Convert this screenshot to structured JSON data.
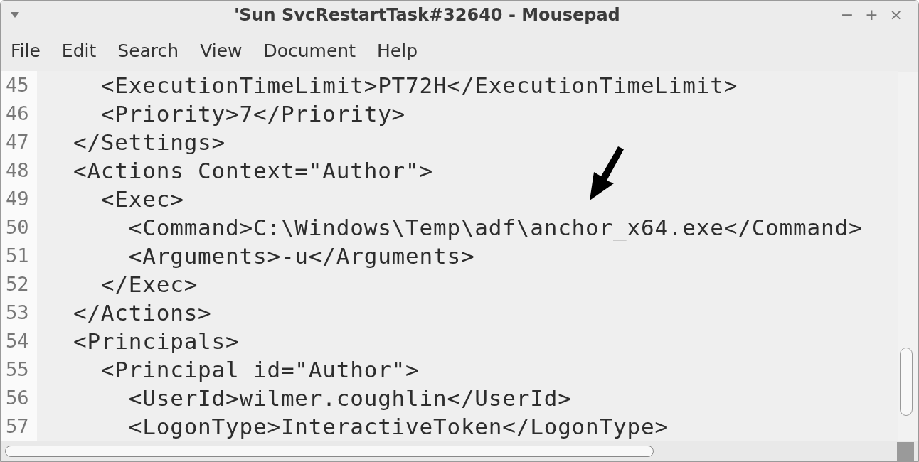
{
  "window": {
    "title": "'Sun SvcRestartTask#32640 - Mousepad",
    "controls": [
      "−",
      "+",
      "×"
    ]
  },
  "menu": [
    "File",
    "Edit",
    "Search",
    "View",
    "Document",
    "Help"
  ],
  "editor": {
    "lines": [
      {
        "number": "45",
        "code": "    <ExecutionTimeLimit>PT72H</ExecutionTimeLimit>"
      },
      {
        "number": "46",
        "code": "    <Priority>7</Priority>"
      },
      {
        "number": "47",
        "code": "  </Settings>"
      },
      {
        "number": "48",
        "code": "  <Actions Context=\"Author\">"
      },
      {
        "number": "49",
        "code": "    <Exec>"
      },
      {
        "number": "50",
        "code": "      <Command>C:\\Windows\\Temp\\adf\\anchor_x64.exe</Command>"
      },
      {
        "number": "51",
        "code": "      <Arguments>-u</Arguments>"
      },
      {
        "number": "52",
        "code": "    </Exec>"
      },
      {
        "number": "53",
        "code": "  </Actions>"
      },
      {
        "number": "54",
        "code": "  <Principals>"
      },
      {
        "number": "55",
        "code": "    <Principal id=\"Author\">"
      },
      {
        "number": "56",
        "code": "      <UserId>wilmer.coughlin</UserId>"
      },
      {
        "number": "57",
        "code": "      <LogonType>InteractiveToken</LogonType>"
      }
    ]
  }
}
